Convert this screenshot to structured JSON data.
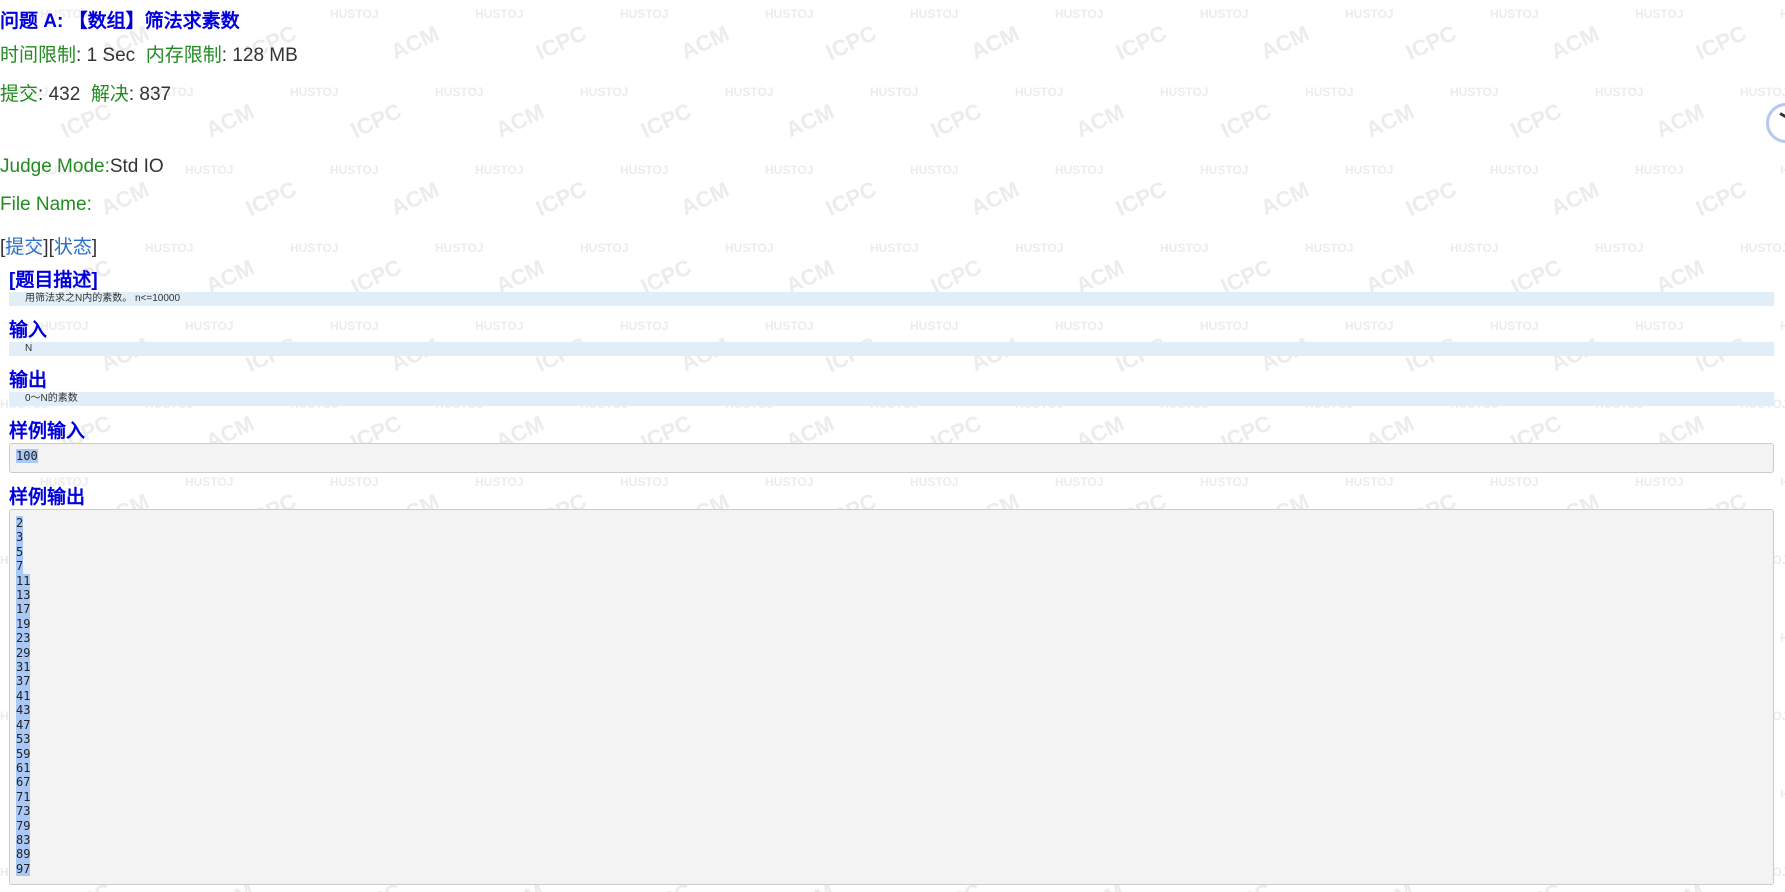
{
  "problem": {
    "title": "问题 A: 【数组】筛法求素数",
    "time_limit_label": "时间限制",
    "time_limit_value": ": 1 Sec",
    "memory_limit_label": "内存限制",
    "memory_limit_value": ": 128 MB",
    "submit_label": "提交",
    "submit_value": ": 432",
    "solved_label": "解决",
    "solved_value": ": 837",
    "judge_mode_label": "Judge Mode:",
    "judge_mode_value": "Std IO",
    "file_name_label": "File Name:",
    "file_name_value": "",
    "links": {
      "open_bracket": "[",
      "submit": "提交",
      "middle": "][",
      "status": "状态",
      "close_bracket": "]"
    }
  },
  "sections": {
    "description_title": "[题目描述]",
    "description_text": "用筛法求之N内的素数。 n<=10000",
    "input_title": "输入",
    "input_text": "N",
    "output_title": "输出",
    "output_text": "0～N的素数",
    "sample_input_title": "样例输入",
    "sample_input": "100",
    "sample_output_title": "样例输出",
    "sample_output": [
      "2",
      "3",
      "5",
      "7",
      "11",
      "13",
      "17",
      "19",
      "23",
      "29",
      "31",
      "37",
      "41",
      "43",
      "47",
      "53",
      "59",
      "61",
      "67",
      "71",
      "73",
      "79",
      "83",
      "89",
      "97"
    ]
  },
  "watermark": {
    "words": [
      "HUSTOJ",
      "ACM",
      "ICPC"
    ]
  }
}
